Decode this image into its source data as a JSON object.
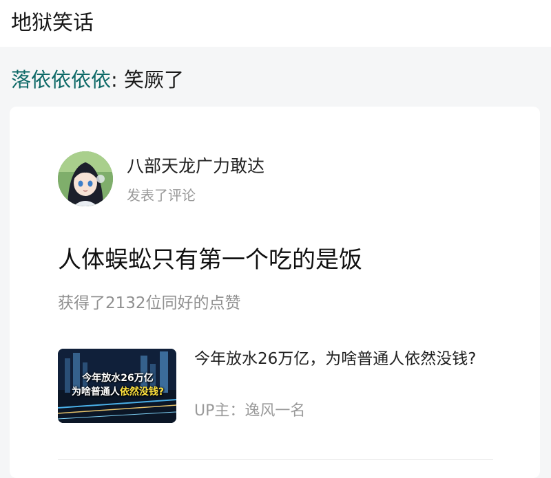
{
  "header": {
    "title": "地狱笑话"
  },
  "reply": {
    "author": "落依依依依",
    "separator": ": ",
    "text": "笑厥了"
  },
  "comment_card": {
    "user": {
      "name": "八部天龙广力敢达",
      "action": "发表了评论",
      "avatar_icon": "anime-girl-avatar"
    },
    "comment": "人体蜈蚣只有第一个吃的是饭",
    "likes": "获得了2132位同好的点赞",
    "video": {
      "thumbnail_caption_line1": "今年放水26万亿",
      "thumbnail_caption_line2_white": "为啥普通人",
      "thumbnail_caption_line2_yellow": "依然没钱?",
      "title": "今年放水26万亿，为啥普通人依然没钱?",
      "uploader": "UP主：逸风一名"
    }
  },
  "colors": {
    "reply_author": "#0f6a68",
    "background": "#f5f6f7",
    "card": "#ffffff",
    "muted_text": "#9a9a9a"
  }
}
